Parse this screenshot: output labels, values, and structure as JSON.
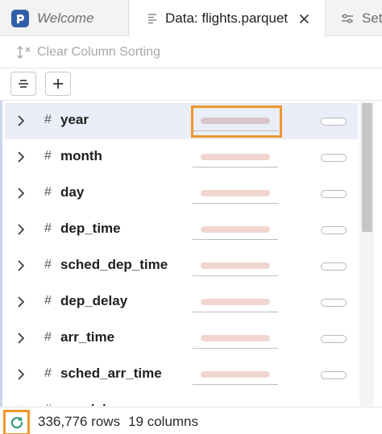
{
  "tabs": {
    "welcome": "Welcome",
    "data": "Data: flights.parquet",
    "settings": "Set"
  },
  "toolbar": {
    "clear_sorting": "Clear Column Sorting"
  },
  "columns": [
    {
      "type": "#",
      "name": "year"
    },
    {
      "type": "#",
      "name": "month"
    },
    {
      "type": "#",
      "name": "day"
    },
    {
      "type": "#",
      "name": "dep_time"
    },
    {
      "type": "#",
      "name": "sched_dep_time"
    },
    {
      "type": "#",
      "name": "dep_delay"
    },
    {
      "type": "#",
      "name": "arr_time"
    },
    {
      "type": "#",
      "name": "sched_arr_time"
    },
    {
      "type": "#",
      "name": "arr_delay"
    }
  ],
  "status": {
    "rows": "336,776 rows",
    "columns": "19 columns"
  },
  "colors": {
    "accent_highlight": "#f0962d",
    "selected_row": "#e9eef8",
    "sparkline": "#f1d6cf"
  }
}
